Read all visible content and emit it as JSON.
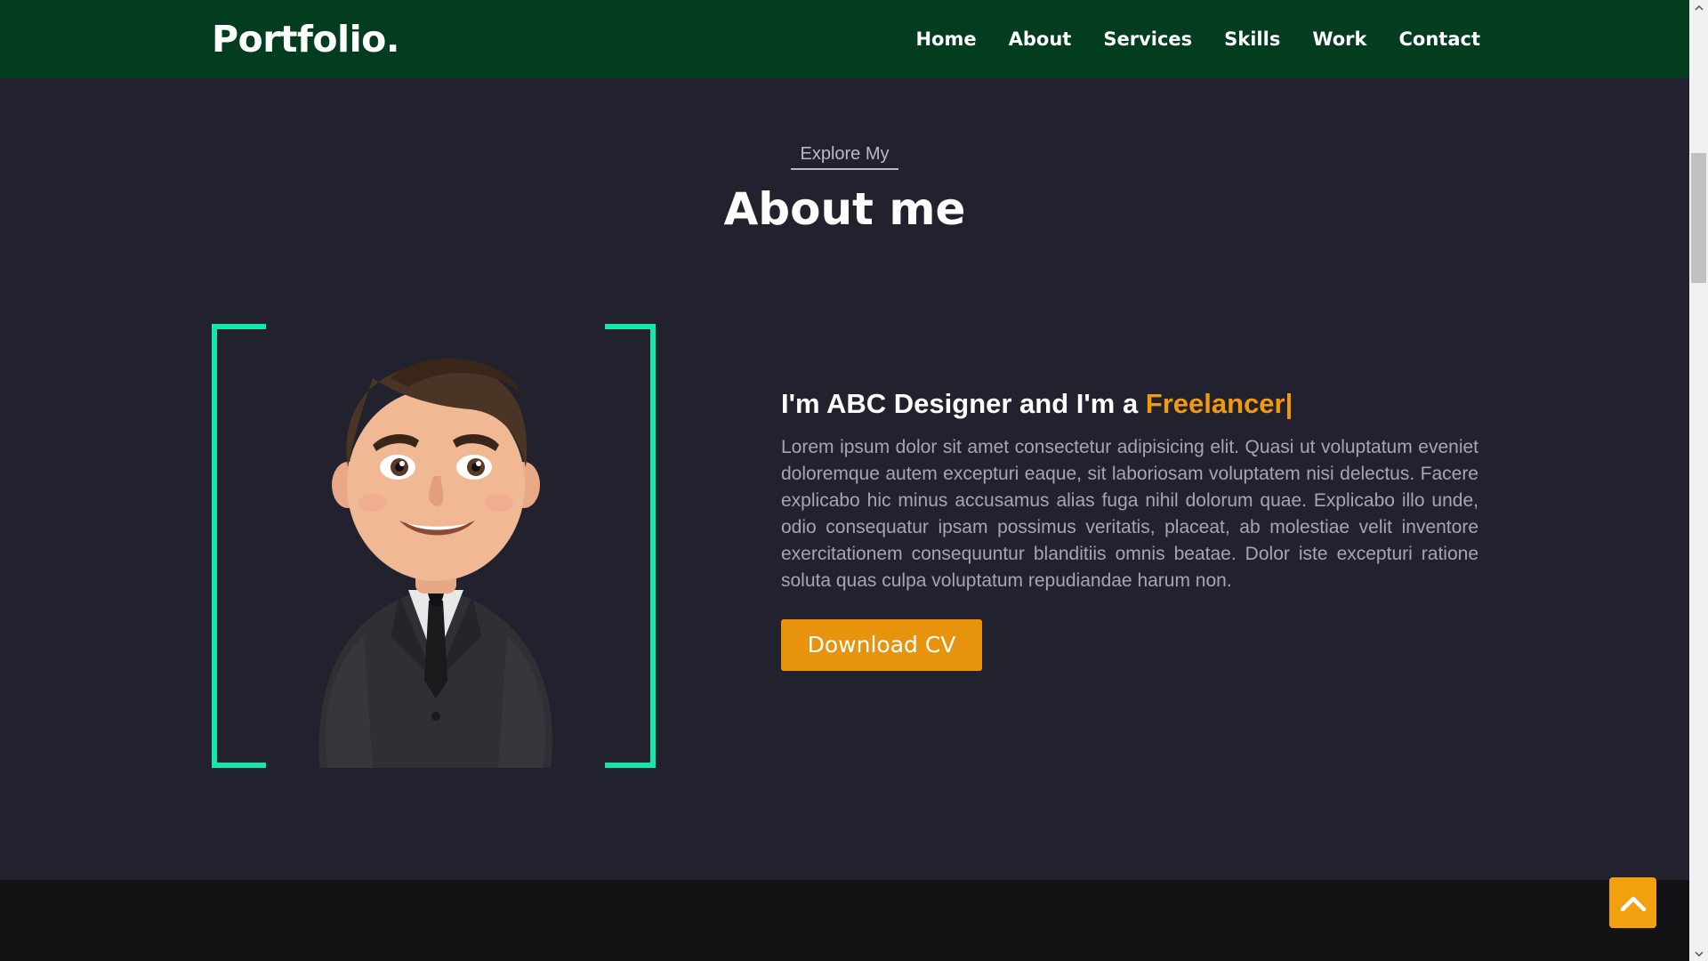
{
  "header": {
    "logo": "Portfolio.",
    "nav": [
      "Home",
      "About",
      "Services",
      "Skills",
      "Work",
      "Contact"
    ]
  },
  "section": {
    "subtitle": "Explore My",
    "title": "About me"
  },
  "about": {
    "heading_prefix": "I'm ABC Designer and I'm a ",
    "heading_accent": "Freelancer|",
    "paragraph": "Lorem ipsum dolor sit amet consectetur adipisicing elit. Quasi ut voluptatum eveniet doloremque autem excepturi eaque, sit laboriosam voluptatem nisi delectus. Facere explicabo hic minus accusamus alias fuga nihil dolorum quae. Explicabo illo unde, odio consequatur ipsam possimus veritatis, placeat, ab molestiae velit inventore exercitationem consequuntur blanditiis omnis beatae. Dolor iste excepturi ratione soluta quas culpa voluptatum repudiandae harum non.",
    "button_label": "Download CV",
    "avatar_icon": "cartoon-businessman-avatar"
  },
  "back_to_top_icon": "chevron-up-icon",
  "colors": {
    "header_bg": "#023d1f",
    "page_bg": "#21222e",
    "frame_accent": "#12e8a8",
    "highlight": "#f29a0e",
    "button_bg": "#e8930e"
  }
}
